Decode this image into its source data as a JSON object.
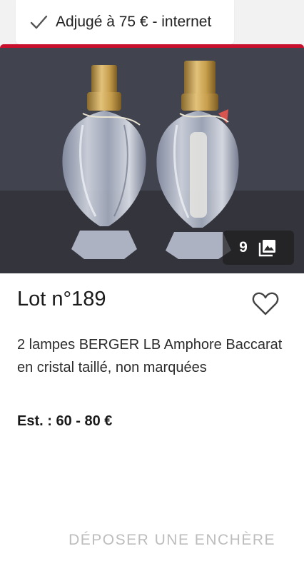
{
  "status": {
    "label": "Adjugé à 75 € - internet",
    "icon": "checkmark-icon"
  },
  "accent_color": "#c8102e",
  "lot": {
    "title": "Lot n°189",
    "description": "2 lampes BERGER LB Amphore Baccarat en cristal taillé, non marquées",
    "estimate": "Est. : 60 - 80 €",
    "photo_count": "9",
    "photo_icon": "photo-gallery-icon",
    "favorite_icon": "heart-outline-icon"
  },
  "actions": {
    "bid_label": "DÉPOSER UNE ENCHÈRE"
  }
}
